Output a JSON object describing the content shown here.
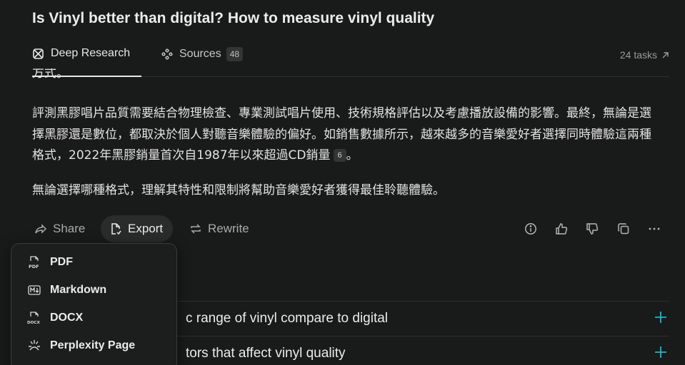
{
  "page_title": "Is Vinyl better than digital? How to measure vinyl quality",
  "tabs": {
    "deep_research": "Deep Research",
    "sources": "Sources",
    "sources_count": "48",
    "tasks": "24 tasks"
  },
  "answer": {
    "cut_text": "方式。",
    "para1_part1": "評測黑膠唱片品質需要結合物理檢查、專業測試唱片使用、技術規格評估以及考慮播放設備的影響。最終，無論是選擇黑膠還是數位，都取決於個人對聽音樂體驗的偏好。如銷售數據所示，越來越多的音樂愛好者選擇同時體驗這兩種格式，2022年黑膠銷量首次自1987年以來超過CD銷量",
    "para1_cite": "6",
    "para1_end": "。",
    "para2": "無論選擇哪種格式，理解其特性和限制將幫助音樂愛好者獲得最佳聆聽體驗。"
  },
  "actions": {
    "share": "Share",
    "export": "Export",
    "rewrite": "Rewrite"
  },
  "icons": {
    "info": "info-icon",
    "like": "thumbs-up-icon",
    "dislike": "thumbs-down-icon",
    "copy": "copy-icon",
    "more": "more-icon"
  },
  "related": [
    {
      "text": "c range of vinyl compare to digital"
    },
    {
      "text": "tors that affect vinyl quality"
    }
  ],
  "export_menu": {
    "pdf": "PDF",
    "markdown": "Markdown",
    "docx": "DOCX",
    "perplexity_page": "Perplexity Page"
  },
  "colors": {
    "background": "#191a1a",
    "accent_teal": "#20b8cd",
    "badge_bg": "#333535"
  }
}
